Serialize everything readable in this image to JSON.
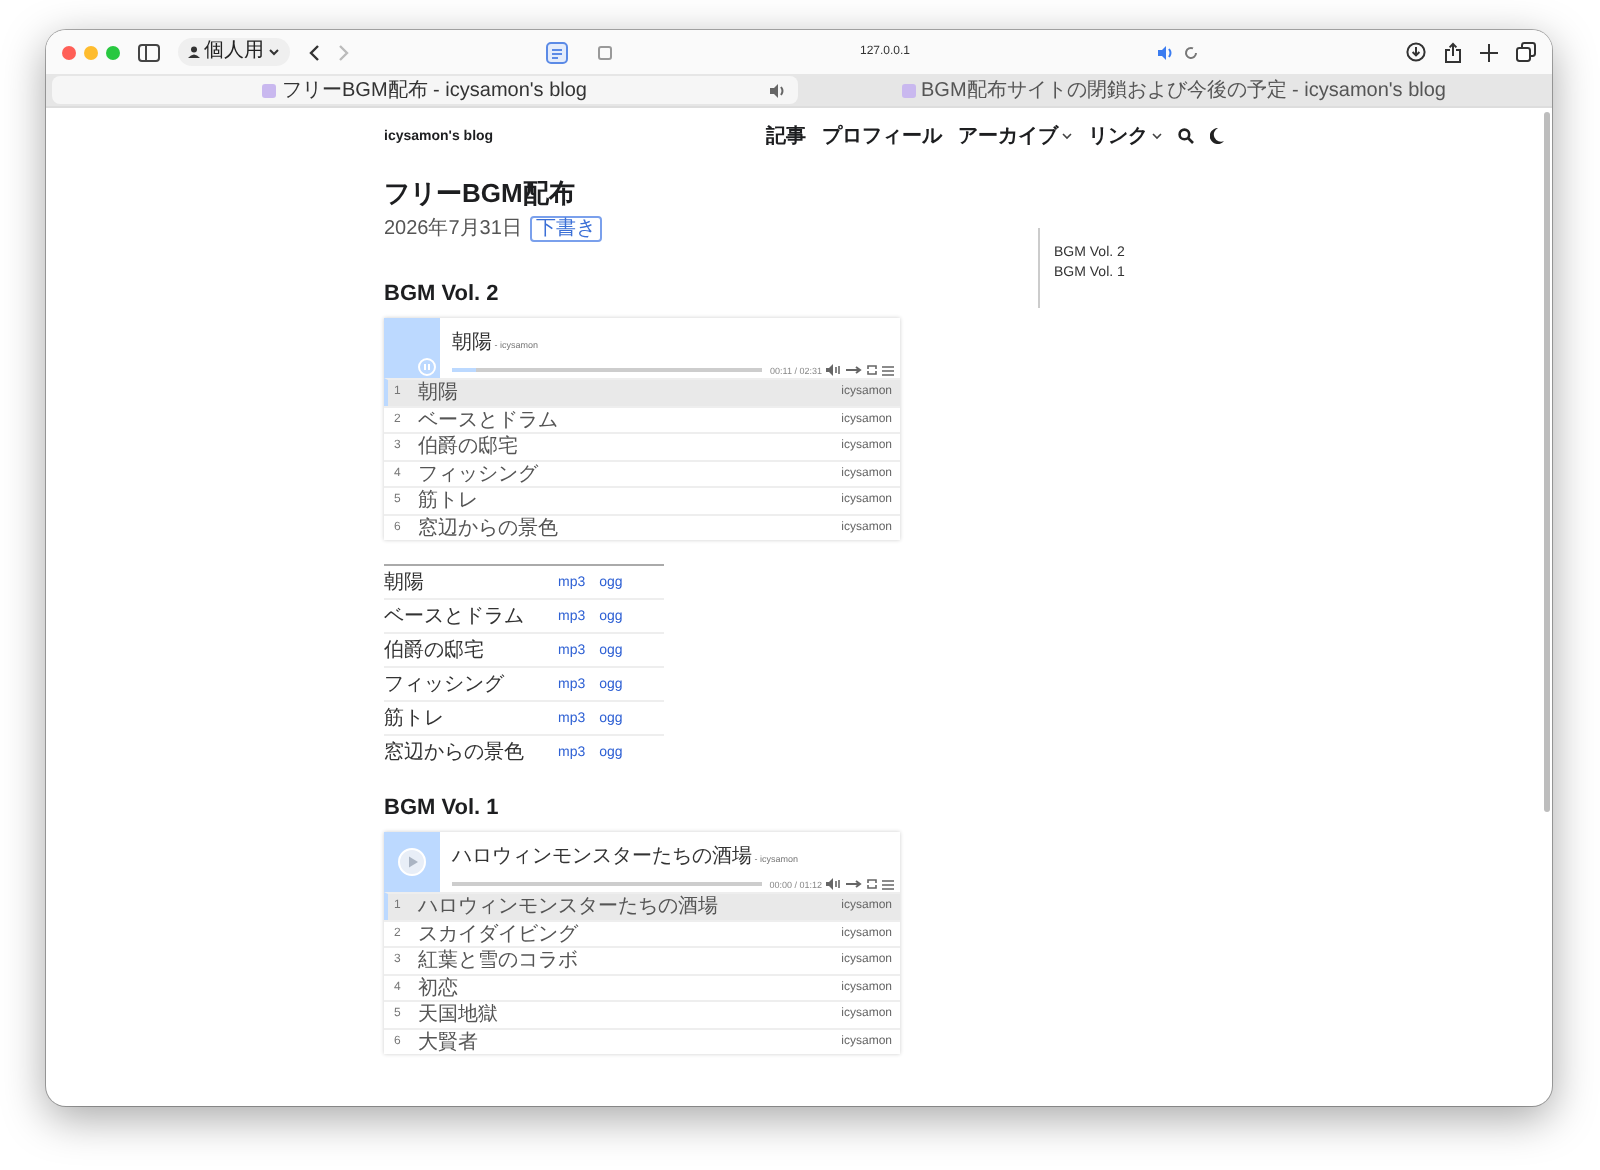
{
  "browser": {
    "profile": "個人用",
    "address": "127.0.0.1",
    "address_audio": true,
    "tabs": [
      {
        "title": "フリーBGM配布 - icysamon's blog",
        "selected": true,
        "audio": true
      },
      {
        "title": "BGM配布サイトの閉鎖および今後の予定 - icysamon's blog",
        "selected": false,
        "audio": false
      }
    ]
  },
  "site": {
    "title": "icysamon's blog",
    "nav": [
      {
        "label": "記事",
        "dropdown": false
      },
      {
        "label": "プロフィール",
        "dropdown": false
      },
      {
        "label": "アーカイブ",
        "dropdown": true
      },
      {
        "label": "リンク",
        "dropdown": true
      }
    ]
  },
  "post": {
    "title": "フリーBGM配布",
    "date": "2026年7月31日",
    "badge": "下書き"
  },
  "toc": [
    "BGM Vol. 2",
    "BGM Vol. 1"
  ],
  "sections": [
    {
      "heading": "BGM Vol. 2",
      "player": {
        "playing": true,
        "title": "朝陽",
        "artist": "- icysamon",
        "time": "00:11 / 02:31",
        "level": 0.08,
        "tracks": [
          {
            "number": "1",
            "title": "朝陽",
            "artist": "icysamon",
            "selected": true
          },
          {
            "number": "2",
            "title": "ベースとドラム",
            "artist": "icysamon",
            "selected": false
          },
          {
            "number": "3",
            "title": "伯爵の邸宅",
            "artist": "icysamon",
            "selected": false
          },
          {
            "number": "4",
            "title": "フィッシング",
            "artist": "icysamon",
            "selected": false
          },
          {
            "number": "5",
            "title": "筋トレ",
            "artist": "icysamon",
            "selected": false
          },
          {
            "number": "6",
            "title": "窓辺からの景色",
            "artist": "icysamon",
            "selected": false
          }
        ]
      },
      "downloads": [
        {
          "title": "朝陽",
          "links": [
            "mp3",
            "ogg"
          ]
        },
        {
          "title": "ベースとドラム",
          "links": [
            "mp3",
            "ogg"
          ]
        },
        {
          "title": "伯爵の邸宅",
          "links": [
            "mp3",
            "ogg"
          ]
        },
        {
          "title": "フィッシング",
          "links": [
            "mp3",
            "ogg"
          ]
        },
        {
          "title": "筋トレ",
          "links": [
            "mp3",
            "ogg"
          ]
        },
        {
          "title": "窓辺からの景色",
          "links": [
            "mp3",
            "ogg"
          ]
        }
      ]
    },
    {
      "heading": "BGM Vol. 1",
      "player": {
        "playing": false,
        "title": "ハロウィンモンスターたちの酒場",
        "artist": "- icysamon",
        "time": "00:00 / 01:12",
        "level": 0,
        "tracks": [
          {
            "number": "1",
            "title": "ハロウィンモンスターたちの酒場",
            "artist": "icysamon",
            "selected": true
          },
          {
            "number": "2",
            "title": "スカイダイビング",
            "artist": "icysamon",
            "selected": false
          },
          {
            "number": "3",
            "title": "紅葉と雪のコラボ",
            "artist": "icysamon",
            "selected": false
          },
          {
            "number": "4",
            "title": "初恋",
            "artist": "icysamon",
            "selected": false
          },
          {
            "number": "5",
            "title": "天国地獄",
            "artist": "icysamon",
            "selected": false
          },
          {
            "number": "6",
            "title": "大賢者",
            "artist": "icysamon",
            "selected": false
          }
        ]
      }
    }
  ]
}
